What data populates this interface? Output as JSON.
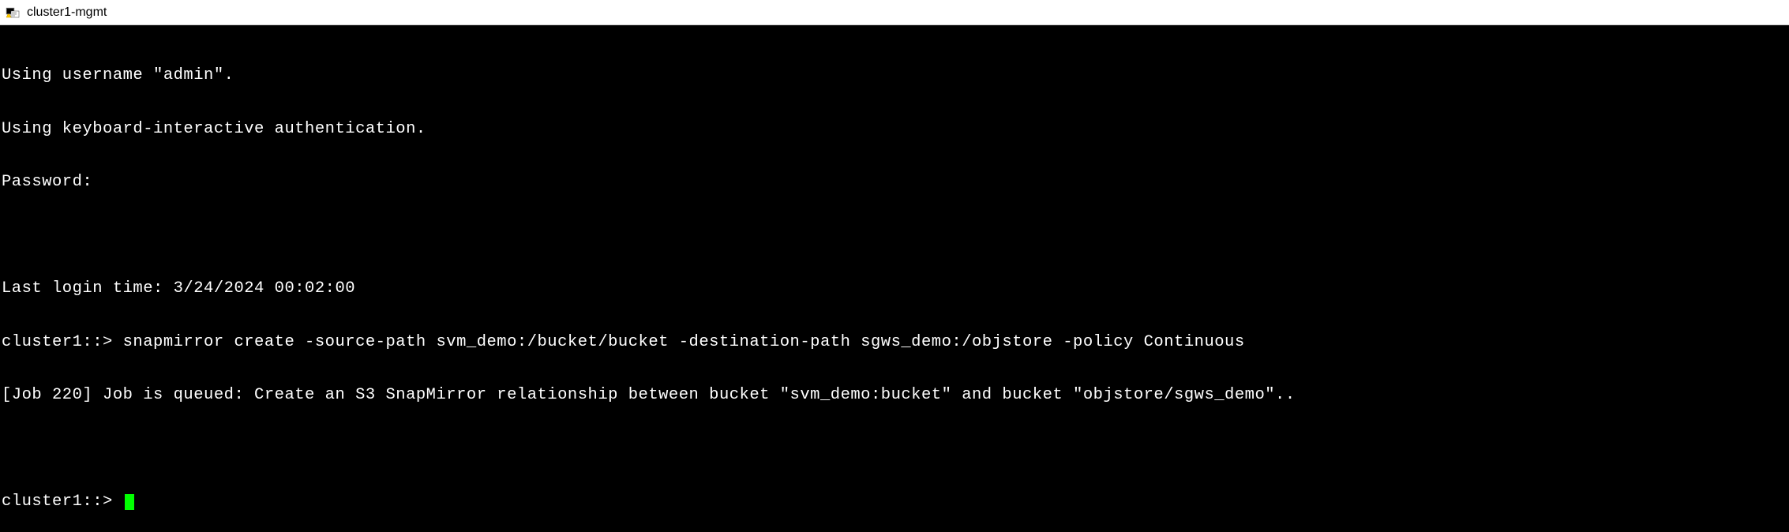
{
  "titlebar": {
    "title": "cluster1-mgmt"
  },
  "terminal": {
    "lines": [
      "Using username \"admin\".",
      "Using keyboard-interactive authentication.",
      "Password:",
      "",
      "Last login time: 3/24/2024 00:02:00",
      "cluster1::> snapmirror create -source-path svm_demo:/bucket/bucket -destination-path sgws_demo:/objstore -policy Continuous",
      "[Job 220] Job is queued: Create an S3 SnapMirror relationship between bucket \"svm_demo:bucket\" and bucket \"objstore/sgws_demo\"..",
      ""
    ],
    "prompt": "cluster1::> "
  }
}
